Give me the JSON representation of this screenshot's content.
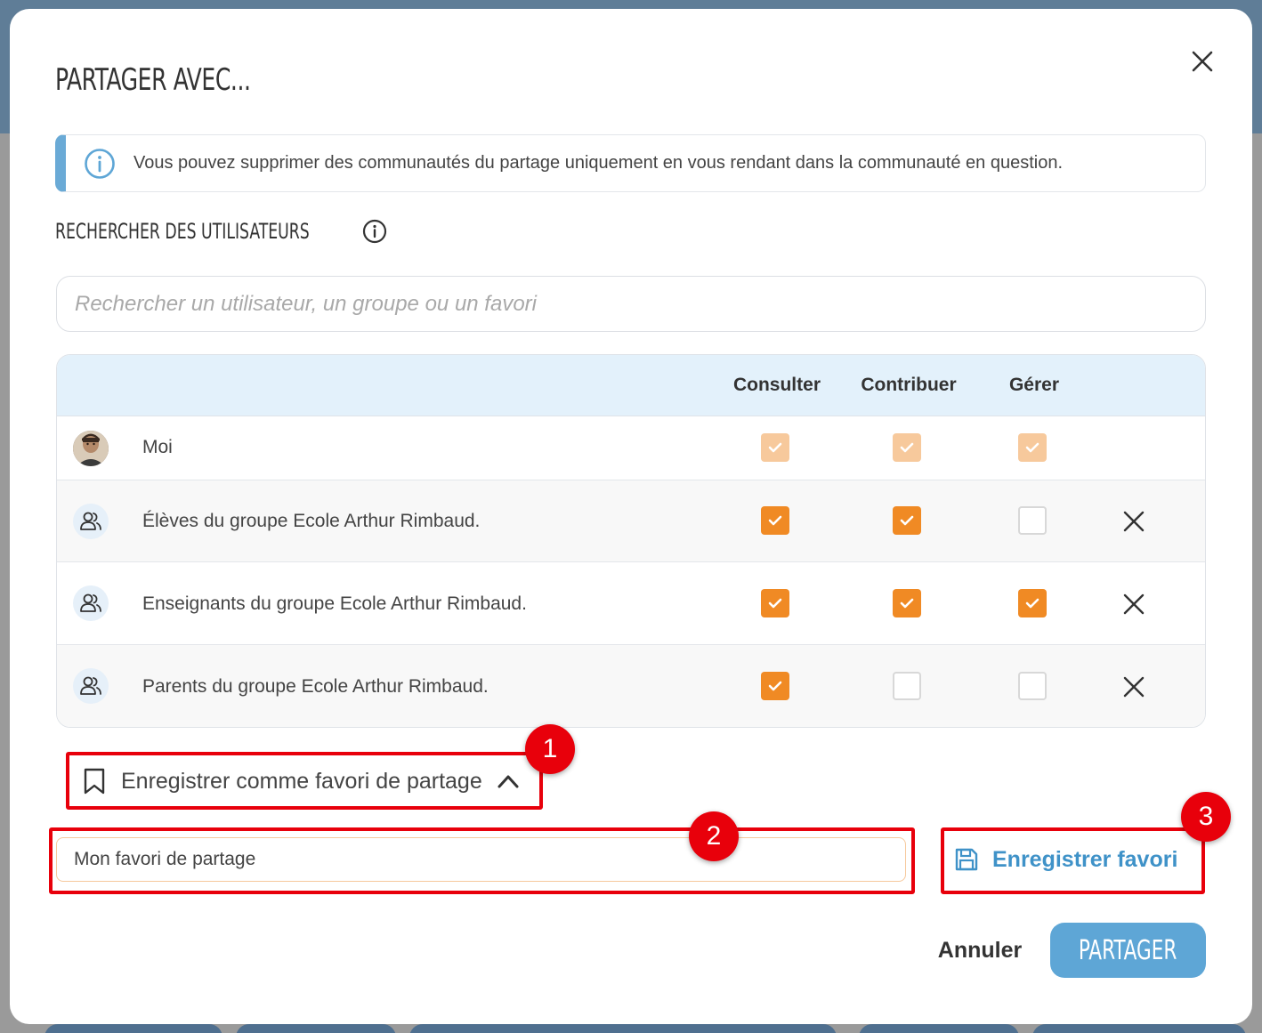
{
  "modal": {
    "title": "PARTAGER AVEC..."
  },
  "info": {
    "text": "Vous pouvez supprimer des communautés du partage uniquement en vous rendant dans la communauté en question."
  },
  "search": {
    "label": "RECHERCHER DES UTILISATEURS",
    "placeholder": "Rechercher un utilisateur, un groupe ou un favori"
  },
  "table": {
    "columns": [
      "Consulter",
      "Contribuer",
      "Gérer"
    ],
    "rows": [
      {
        "name": "Moi",
        "type": "user-photo",
        "consulter": "disabled-checked",
        "contribuer": "disabled-checked",
        "gerer": "disabled-checked",
        "removable": false
      },
      {
        "name": "Élèves du groupe Ecole Arthur Rimbaud.",
        "type": "group",
        "consulter": "checked",
        "contribuer": "checked",
        "gerer": "unchecked",
        "removable": true
      },
      {
        "name": "Enseignants du groupe Ecole Arthur Rimbaud.",
        "type": "group",
        "consulter": "checked",
        "contribuer": "checked",
        "gerer": "checked",
        "removable": true
      },
      {
        "name": "Parents du groupe Ecole Arthur Rimbaud.",
        "type": "group",
        "consulter": "checked",
        "contribuer": "unchecked",
        "gerer": "unchecked",
        "removable": true
      }
    ]
  },
  "favorite": {
    "toggle_label": "Enregistrer comme favori de partage",
    "name_value": "Mon favori de partage",
    "save_label": "Enregistrer favori"
  },
  "markers": [
    "1",
    "2",
    "3"
  ],
  "footer": {
    "cancel_label": "Annuler",
    "share_label": "PARTAGER"
  },
  "colors": {
    "accent_orange": "#f08a24",
    "accent_blue": "#5ea6d6",
    "highlight_red": "#e8000b",
    "table_header_bg": "#e3f1fb"
  }
}
